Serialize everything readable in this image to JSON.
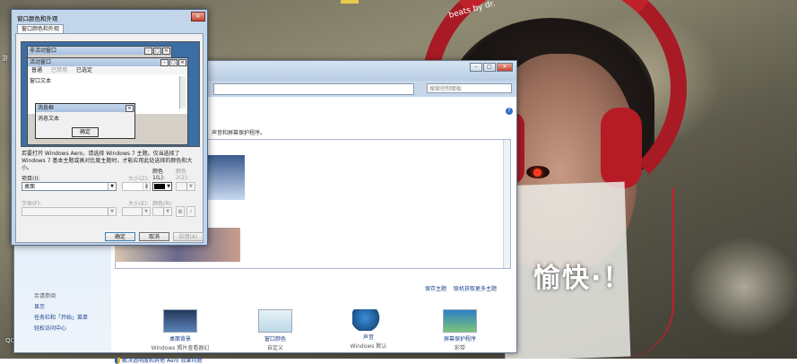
{
  "colors": {
    "accent_blue": "#1a3f8c",
    "headphone_red": "#c2202a",
    "window_frame": "#c6d7ea"
  },
  "desktop": {
    "sign_text": "愉快·！",
    "headphone_brand": "beats by dr.",
    "left_labels": [
      "QQ",
      "游"
    ]
  },
  "personalization_window": {
    "search_placeholder": "搜索控制面板",
    "description": "声音和屏幕保护程序。",
    "nav": {
      "see_also": "另请参阅",
      "links": [
        "显示",
        "任务栏和「开始」菜单",
        "轻松访问中心"
      ]
    },
    "theme_links": {
      "save": "保存主题",
      "online": "联机获取更多主题"
    },
    "bottom_items": [
      {
        "label": "桌面背景",
        "sub": "Windows 照片查看器幻灯"
      },
      {
        "label": "窗口颜色",
        "sub": "自定义"
      },
      {
        "label": "声音",
        "sub": "Windows 默认"
      },
      {
        "label": "屏幕保护程序",
        "sub": "彩带"
      }
    ],
    "aero_link": "解决透明度和其他 Aero 效果问题"
  },
  "dialog": {
    "title": "窗口颜色和外观",
    "tab": "窗口颜色和外观",
    "preview": {
      "inactive_window": "非活动窗口",
      "active_window": "活动窗口",
      "menu_items": [
        "普通",
        "已禁用",
        "已选定"
      ],
      "window_text": "窗口文本",
      "message_box": "消息框",
      "message_text": "消息文本",
      "ok": "确定"
    },
    "description": "若要打开 Windows Aero，请选择 Windows 7 主题。仅当选择了 Windows 7 基本主题或高对比度主题时，才能应用此处选择的颜色和大小。",
    "item_label": "项目(I):",
    "item_value": "桌面",
    "size_label": "大小(Z):",
    "color1_label": "颜色 1(L):",
    "color2_label": "颜色 2(2):",
    "font_label": "字体(F):",
    "font_size_label": "大小(E):",
    "font_color_label": "颜色(R):",
    "bold_label": "B",
    "italic_label": "I",
    "buttons": {
      "ok": "确定",
      "cancel": "取消",
      "apply": "应用(A)"
    }
  }
}
